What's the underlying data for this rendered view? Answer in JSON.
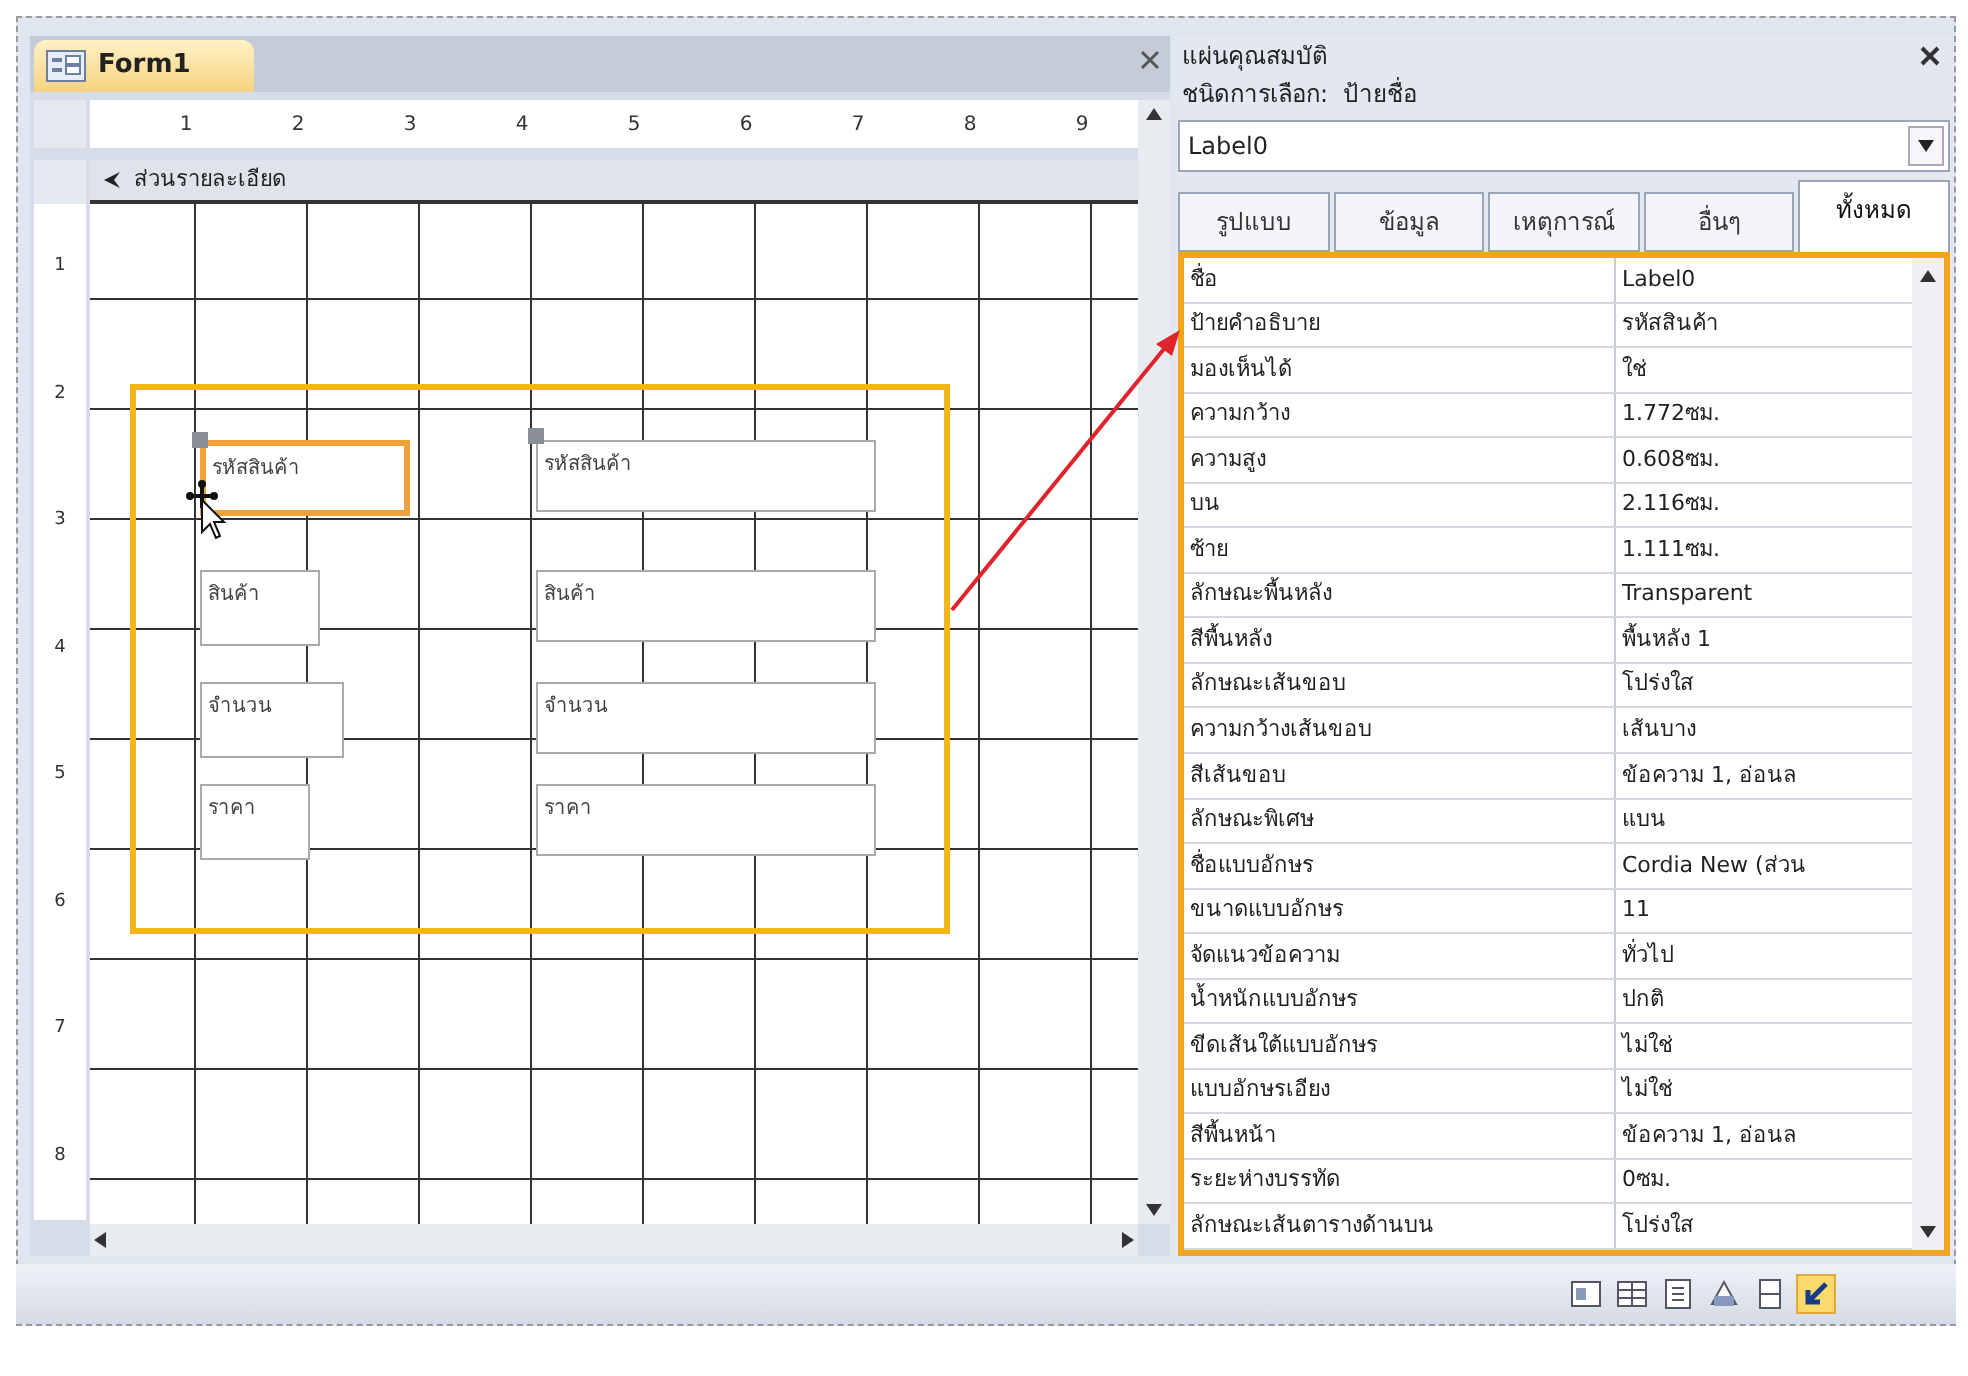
{
  "document_tab": {
    "title": "Form1"
  },
  "ruler": {
    "marks": [
      "1",
      "2",
      "3",
      "4",
      "5",
      "6",
      "7",
      "8",
      "9"
    ]
  },
  "vertical_ruler": {
    "marks": [
      "1",
      "2",
      "3",
      "4",
      "5",
      "6",
      "7",
      "8"
    ]
  },
  "section_header": "ส่วนรายละเอียด",
  "form_controls": [
    {
      "kind": "label",
      "text": "รหัสสินค้า",
      "selected": true
    },
    {
      "kind": "textbox",
      "text": "รหัสสินค้า",
      "selected": false
    },
    {
      "kind": "label",
      "text": "สินค้า",
      "selected": false
    },
    {
      "kind": "textbox",
      "text": "สินค้า",
      "selected": false
    },
    {
      "kind": "label",
      "text": "จำนวน",
      "selected": false
    },
    {
      "kind": "textbox",
      "text": "จำนวน",
      "selected": false
    },
    {
      "kind": "label",
      "text": "ราคา",
      "selected": false
    },
    {
      "kind": "textbox",
      "text": "ราคา",
      "selected": false
    }
  ],
  "property_sheet": {
    "title": "แผ่นคุณสมบัติ",
    "selection_type": "ชนิดการเลือก:  ป้ายชื่อ",
    "object": "Label0",
    "tabs": [
      {
        "label": "รูปแบบ",
        "selected": false
      },
      {
        "label": "ข้อมูล",
        "selected": false
      },
      {
        "label": "เหตุการณ์",
        "selected": false
      },
      {
        "label": "อื่นๆ",
        "selected": false
      },
      {
        "label": "ทั้งหมด",
        "selected": true
      }
    ],
    "properties": [
      {
        "name": "ชื่อ",
        "value": "Label0"
      },
      {
        "name": "ป้ายคำอธิบาย",
        "value": "รหัสสินค้า"
      },
      {
        "name": "มองเห็นได้",
        "value": "ใช่"
      },
      {
        "name": "ความกว้าง",
        "value": "1.772ซม."
      },
      {
        "name": "ความสูง",
        "value": "0.608ซม."
      },
      {
        "name": "บน",
        "value": "2.116ซม."
      },
      {
        "name": "ซ้าย",
        "value": "1.111ซม."
      },
      {
        "name": "ลักษณะพื้นหลัง",
        "value": "Transparent"
      },
      {
        "name": "สีพื้นหลัง",
        "value": "พื้นหลัง 1"
      },
      {
        "name": "ลักษณะเส้นขอบ",
        "value": "โปร่งใส"
      },
      {
        "name": "ความกว้างเส้นขอบ",
        "value": "เส้นบาง"
      },
      {
        "name": "สีเส้นขอบ",
        "value": "ข้อความ 1, อ่อนล"
      },
      {
        "name": "ลักษณะพิเศษ",
        "value": "แบน"
      },
      {
        "name": "ชื่อแบบอักษร",
        "value": "Cordia New (ส่วน"
      },
      {
        "name": "ขนาดแบบอักษร",
        "value": "11"
      },
      {
        "name": "จัดแนวข้อความ",
        "value": "ทั่วไป"
      },
      {
        "name": "น้ำหนักแบบอักษร",
        "value": "ปกติ"
      },
      {
        "name": "ขีดเส้นใต้แบบอักษร",
        "value": "ไม่ใช่"
      },
      {
        "name": "แบบอักษรเอียง",
        "value": "ไม่ใช่"
      },
      {
        "name": "สีพื้นหน้า",
        "value": "ข้อความ 1, อ่อนล"
      },
      {
        "name": "ระยะห่างบรรทัด",
        "value": "0ซม."
      },
      {
        "name": "ลักษณะเส้นตารางด้านบน",
        "value": "โปร่งใส"
      }
    ]
  },
  "view_buttons": [
    {
      "selected": false
    },
    {
      "selected": false
    },
    {
      "selected": false
    },
    {
      "selected": false
    },
    {
      "selected": false
    },
    {
      "selected": true
    }
  ]
}
